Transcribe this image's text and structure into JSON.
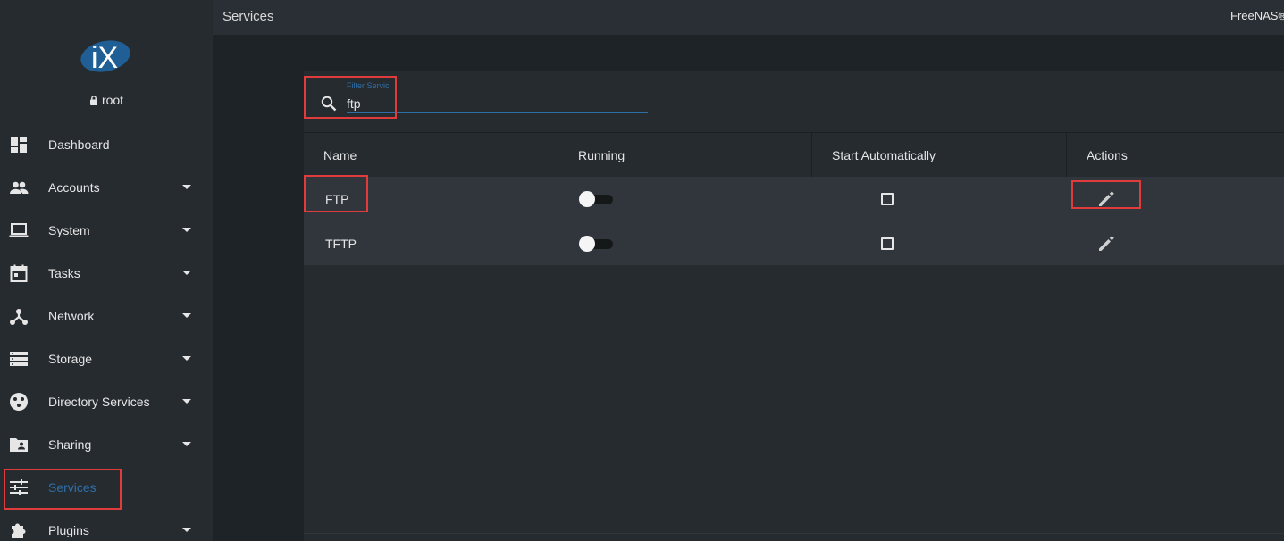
{
  "app": {
    "brand": "FreeNAS®",
    "page_title": "Services"
  },
  "user": {
    "name": "root"
  },
  "sidebar": {
    "items": [
      {
        "label": "Dashboard",
        "icon": "dashboard-icon",
        "has_caret": false
      },
      {
        "label": "Accounts",
        "icon": "people-icon",
        "has_caret": true
      },
      {
        "label": "System",
        "icon": "laptop-icon",
        "has_caret": true
      },
      {
        "label": "Tasks",
        "icon": "calendar-icon",
        "has_caret": true
      },
      {
        "label": "Network",
        "icon": "network-icon",
        "has_caret": true
      },
      {
        "label": "Storage",
        "icon": "storage-icon",
        "has_caret": true
      },
      {
        "label": "Directory Services",
        "icon": "directory-icon",
        "has_caret": true
      },
      {
        "label": "Sharing",
        "icon": "folder-shared-icon",
        "has_caret": true
      },
      {
        "label": "Services",
        "icon": "tune-icon",
        "has_caret": false,
        "active": true
      },
      {
        "label": "Plugins",
        "icon": "extension-icon",
        "has_caret": true
      }
    ]
  },
  "filter": {
    "label": "Filter Servic",
    "value": "ftp"
  },
  "table": {
    "columns": [
      "Name",
      "Running",
      "Start Automatically",
      "Actions"
    ],
    "rows": [
      {
        "name": "FTP",
        "running": false,
        "start_automatically": false
      },
      {
        "name": "TFTP",
        "running": false,
        "start_automatically": false
      }
    ]
  },
  "colors": {
    "accent": "#2f6fa8",
    "highlight": "#e03c3c",
    "sidebar_bg": "#262b30"
  }
}
